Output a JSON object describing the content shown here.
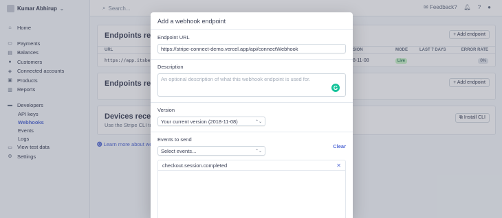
{
  "account": {
    "name": "Kumar Abhirup"
  },
  "topbar": {
    "search_placeholder": "Search...",
    "feedback": "Feedback?"
  },
  "sidebar": {
    "items": [
      {
        "label": "Home"
      },
      {
        "label": "Payments"
      },
      {
        "label": "Balances"
      },
      {
        "label": "Customers"
      },
      {
        "label": "Connected accounts"
      },
      {
        "label": "Products"
      },
      {
        "label": "Reports"
      },
      {
        "label": "Developers"
      }
    ],
    "dev_sub": [
      {
        "label": "API keys"
      },
      {
        "label": "Webhooks"
      },
      {
        "label": "Events"
      },
      {
        "label": "Logs"
      }
    ],
    "view_test_data": "View test data",
    "settings": "Settings"
  },
  "main": {
    "card1": {
      "title": "Endpoints rece",
      "add": "Add endpoint",
      "headers": {
        "url": "URL",
        "version": "SION",
        "mode": "MODE",
        "last7": "LAST 7 DAYS",
        "error": "ERROR RATE"
      },
      "row": {
        "url": "https://app.itsbe",
        "version": "8-11-08",
        "mode": "Live",
        "error": "0%"
      }
    },
    "card2": {
      "title": "Endpoints rece",
      "add": "Add endpoint"
    },
    "card3": {
      "title": "Devices receiv",
      "sub": "Use the Stripe CLI to",
      "btn": "Install CLI"
    },
    "learn": "Learn more about we"
  },
  "modal": {
    "title": "Add a webhook endpoint",
    "endpoint_label": "Endpoint URL",
    "endpoint_value": "https://stripe-connect-demo.vercel.app/api/connectWebhook",
    "description_label": "Description",
    "description_placeholder": "An optional description of what this webhook endpoint is used for.",
    "version_label": "Version",
    "version_value": "Your current version (2018-11-08)",
    "events_label": "Events to send",
    "events_select": "Select events...",
    "clear": "Clear",
    "selected_events": [
      "checkout.session.completed"
    ]
  }
}
